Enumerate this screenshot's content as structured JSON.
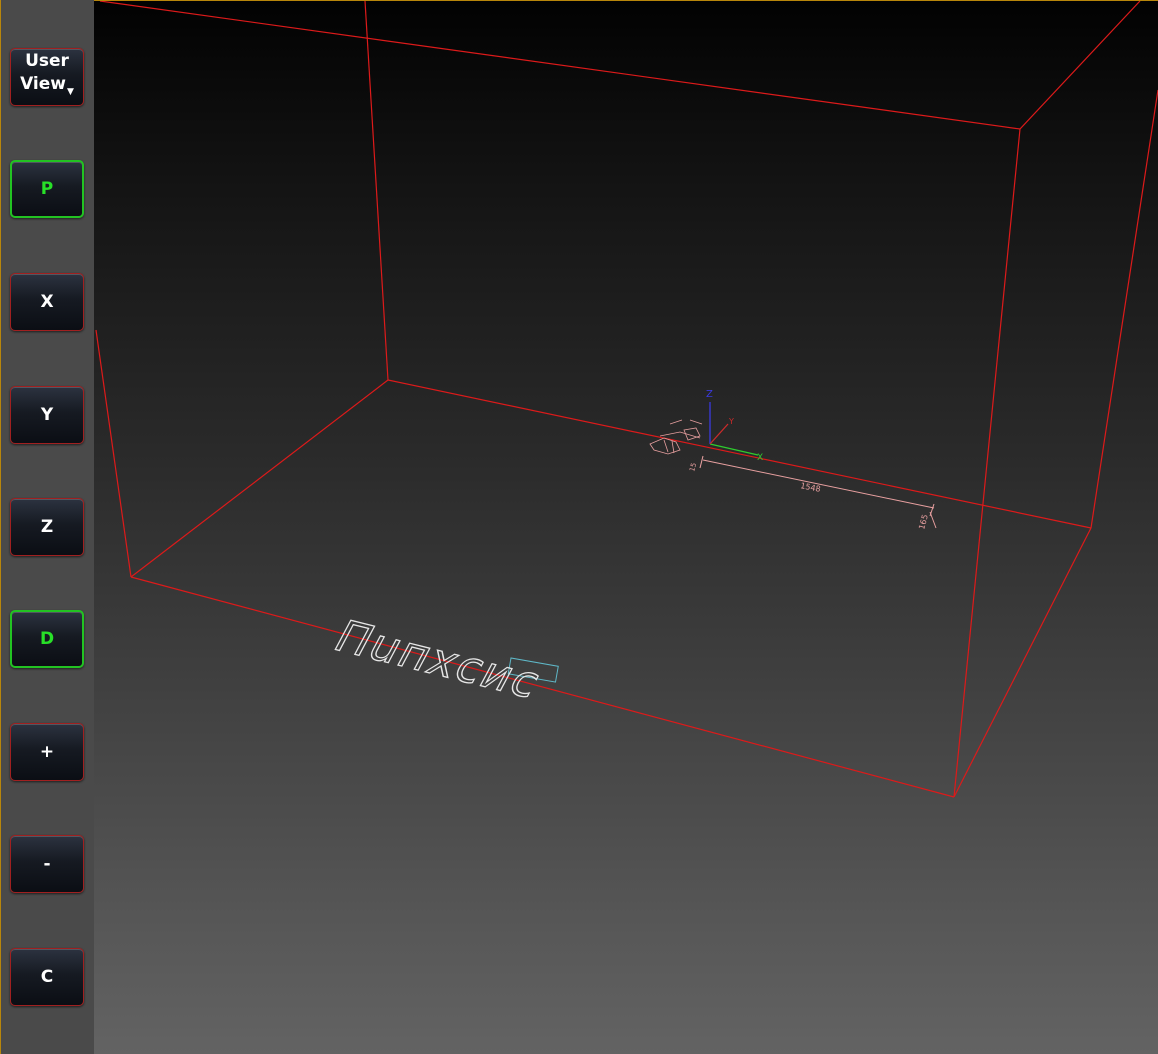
{
  "toolbar": {
    "user_view": {
      "line1": "User",
      "line2": "View"
    },
    "buttons": [
      {
        "key": "p",
        "label": "P",
        "active": true
      },
      {
        "key": "x",
        "label": "X",
        "active": false
      },
      {
        "key": "y",
        "label": "Y",
        "active": false
      },
      {
        "key": "z",
        "label": "Z",
        "active": false
      },
      {
        "key": "d",
        "label": "D",
        "active": true
      },
      {
        "key": "plus",
        "label": "+",
        "active": false
      },
      {
        "key": "minus",
        "label": "-",
        "active": false
      },
      {
        "key": "c",
        "label": "C",
        "active": false
      }
    ]
  },
  "viewport": {
    "axis_labels": {
      "x": "X",
      "y": "Y",
      "z": "Z"
    },
    "colors": {
      "bounding_box": "#dd1a1a",
      "x_axis": "#2ecc2e",
      "y_axis": "#cc2a2a",
      "z_axis": "#3a3ae0",
      "active_border": "#22c322",
      "text_outline": "#e6e6e6",
      "text_highlight": "#5fb8c8",
      "dimension": "#e8a0a0"
    },
    "dimension_labels": [
      "1548",
      "165",
      "15"
    ],
    "engraved_text": "Пuпхсис"
  }
}
